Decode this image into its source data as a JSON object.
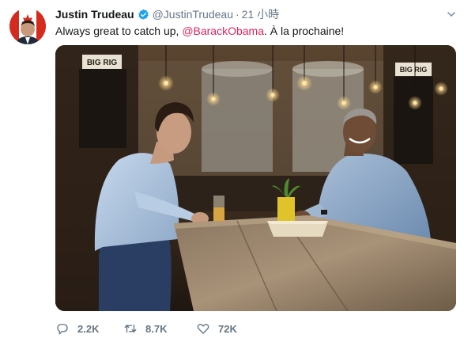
{
  "tweet": {
    "display_name": "Justin Trudeau",
    "handle": "@JustinTrudeau",
    "separator": "·",
    "time": "21 小時",
    "text_before": "Always great to catch up, ",
    "mention": "@BarackObama",
    "text_after": ". À la prochaine!",
    "media": {
      "signs": [
        "BIG RIG",
        "BIG RIG"
      ]
    },
    "actions": {
      "replies": "2.2K",
      "retweets": "8.7K",
      "likes": "72K"
    },
    "icons": [
      "verified-badge-icon",
      "chevron-down-icon",
      "reply-icon",
      "retweet-icon",
      "like-icon"
    ],
    "colors": {
      "mention": "#e0245e",
      "secondary_text": "#657786",
      "verified": "#1da1f2",
      "primary_text": "#14171a"
    }
  }
}
